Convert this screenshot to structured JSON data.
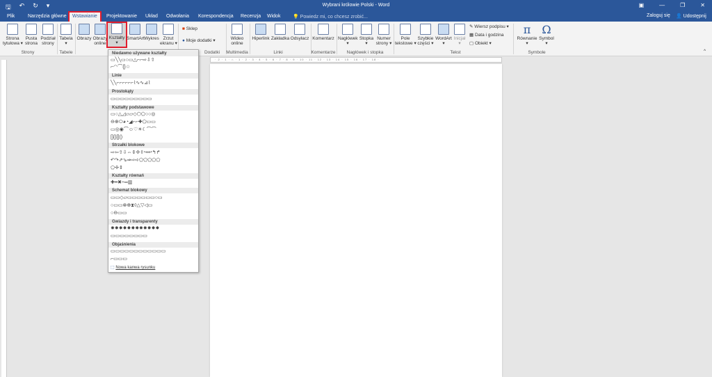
{
  "window": {
    "title": "Wybrani królowie Polski - Word"
  },
  "qat": {
    "save_icon": "save-icon",
    "undo": "↶",
    "redo": "↻",
    "more": "▾"
  },
  "window_controls": {
    "ribbon_display": "▣",
    "minimize": "—",
    "restore": "❐",
    "close": "✕"
  },
  "tabs": [
    "Plik",
    "Narzędzia główne",
    "Wstawianie",
    "Projektowanie",
    "Układ",
    "Odwołania",
    "Korespondencja",
    "Recenzja",
    "Widok"
  ],
  "active_tab": "Wstawianie",
  "tell_me": {
    "placeholder": "Powiedz mi, co chcesz zrobić..."
  },
  "account": {
    "signin": "Zaloguj się",
    "share": "Udostępnij"
  },
  "ribbon": {
    "pages": {
      "cover": "Strona\ntytułowa ▾",
      "blank": "Pusta\nstrona",
      "break": "Podział\nstrony",
      "group": "Strony"
    },
    "tables": {
      "table": "Tabela\n▾",
      "group": "Tabele"
    },
    "illustrations": {
      "pictures": "Obrazy",
      "online": "Obrazy\nonline",
      "shapes": "Kształty\n▾",
      "smartart": "SmartArt",
      "chart": "Wykres",
      "screenshot": "Zrzut\nekranu ▾"
    },
    "addins": {
      "store": "Sklep",
      "myaddins": "Moje dodatki",
      "group": "Dodatki"
    },
    "media": {
      "video": "Wideo\nonline",
      "group": "Multimedia"
    },
    "links": {
      "hyperlink": "Hiperlink",
      "bookmark": "Zakładka",
      "crossref": "Odsyłacz",
      "group": "Linki"
    },
    "comments": {
      "comment": "Komentarz",
      "group": "Komentarze"
    },
    "header_footer": {
      "header": "Nagłówek\n▾",
      "footer": "Stopka\n▾",
      "page_number": "Numer\nstrony ▾",
      "group": "Nagłówek i stopka"
    },
    "text": {
      "textbox": "Pole\ntekstowe ▾",
      "quickparts": "Szybkie\nczęści ▾",
      "wordart": "WordArt\n▾",
      "dropcap": "Inicjał\n▾",
      "signature": "Wiersz podpisu",
      "datetime": "Data i godzina",
      "object": "Obiekt",
      "group": "Tekst"
    },
    "symbols": {
      "equation": "Równanie\n▾",
      "symbol": "Symbol\n▾",
      "group": "Symbole"
    }
  },
  "shapes_menu": {
    "sections": [
      "Niedawno używane kształty",
      "Linie",
      "Prostokąty",
      "Kształty podstawowe",
      "Strzałki blokowe",
      "Kształty równań",
      "Schemat blokowy",
      "Gwiazdy i transparenty",
      "Objaśnienia"
    ],
    "rows": [
      "▭╲╲▭○▭△⌐⌐⇨⇩⇧",
      "⌐◠⌒{}☆",
      "╲╲⌐⌐⌐⌐⌐⌐⌇∿∿⊿⌇",
      "▭▭▭▭▭▭▭▭▭",
      "▭○△◿▱▱◇⬡⬠○○◎",
      "⊖⊕⬭◕◔◢⌐⌐✚⬠▭▭",
      "▭◎◉⌒☺♡☀☾⌒⌒",
      "[]{}[]()",
      "⇨⇦⇧⇩⇔⇕✢⇳↪↩↰↱",
      "↶↷⇗⇘⇒⇨➪⬠⬠⬠⬠⬠",
      "⬠✢⇕",
      "✚━✖÷═▥",
      "▭▭◇▱▭▭▭▭▭▭○▭",
      "○▭▭⊗⊕⧗◊△▽◁▭",
      "○⊖▭▭",
      "✸✸✸✸✸✸✸✸✸✸✸✸",
      "▭▭▭▭▭▭▭▭",
      "▭▭▭▭▭▭▭▭▭▭▭▭",
      "⌐▭▭▭"
    ],
    "new_canvas": "Nowa kanwa rysunku"
  },
  "ruler": {
    "numbers": "· 2 · 1 · ⌂ · 1 · 2 · 3 · 4 · 5 · 6 · 7 · 8 · 9 · 10 · 11 · 12 · 13 · 14 · 15 · 16 · 17 · 18 ·"
  }
}
